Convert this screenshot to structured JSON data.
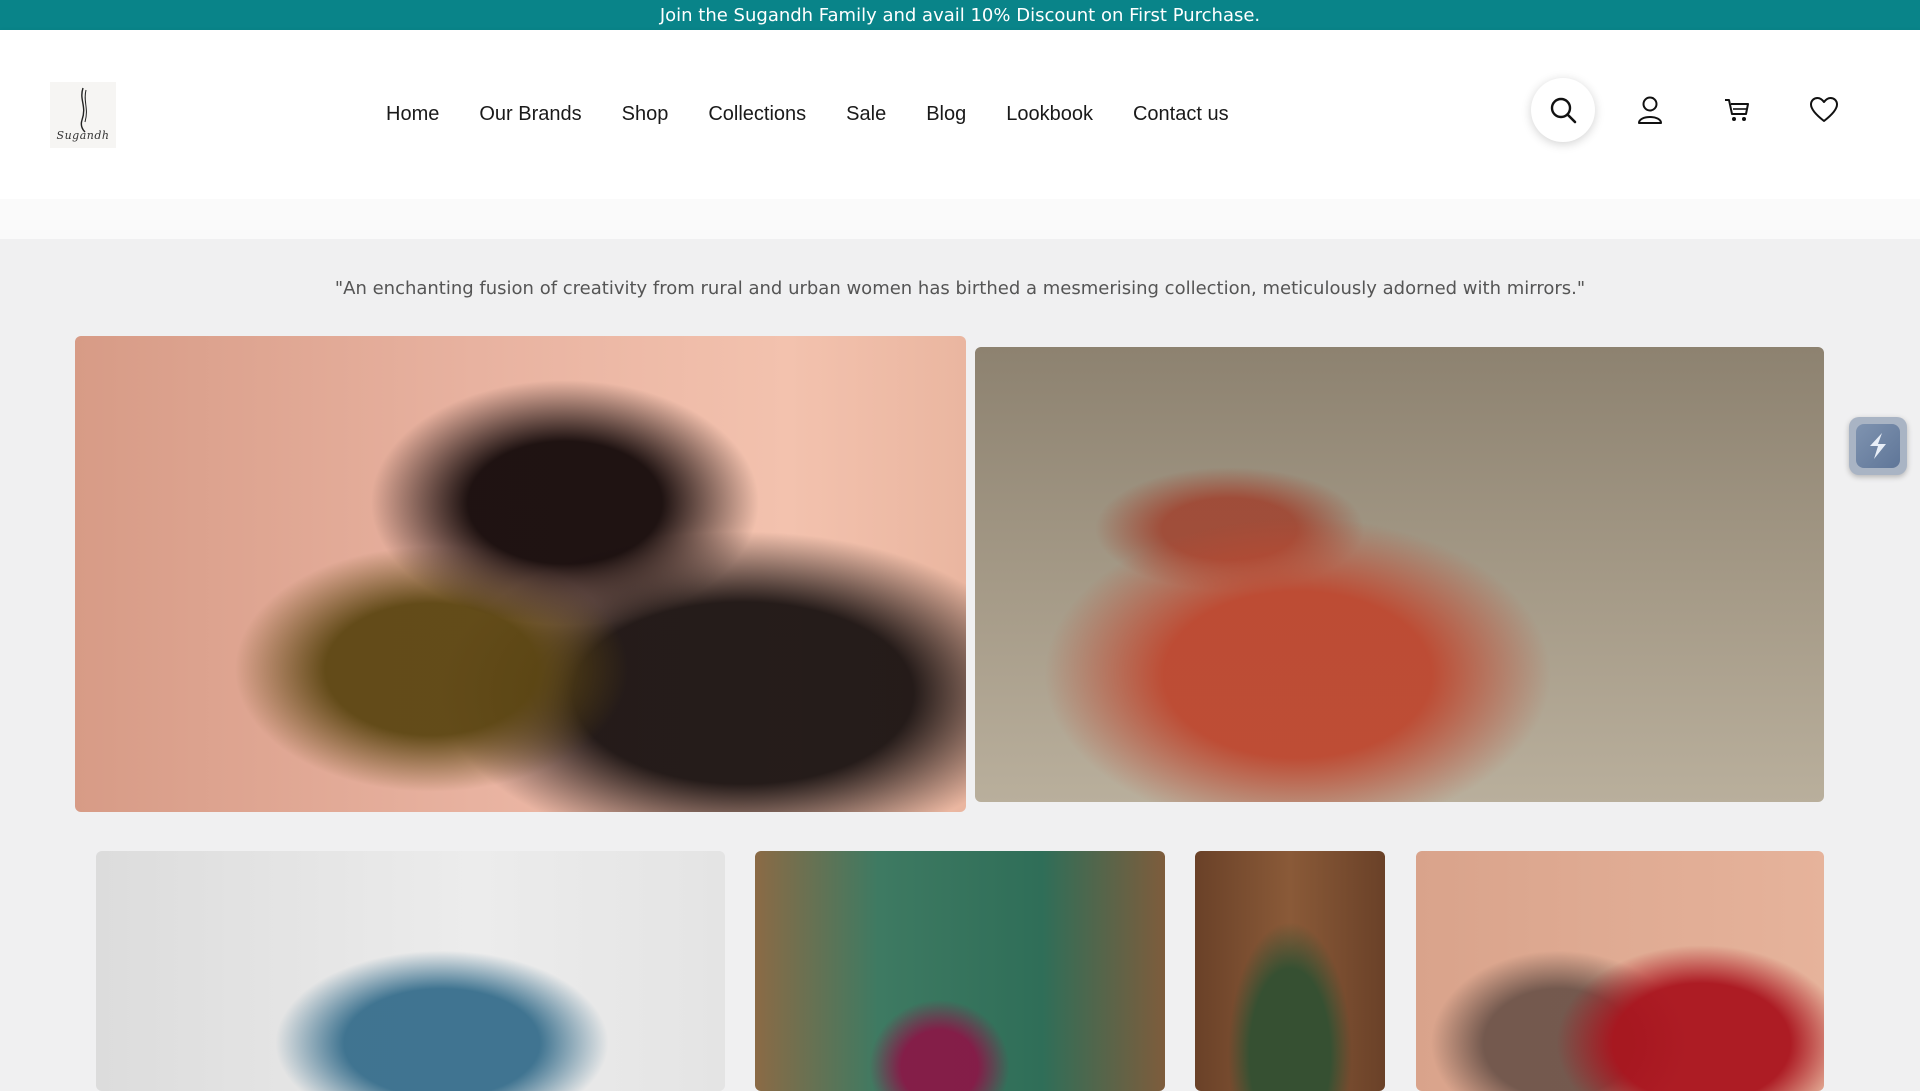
{
  "announcement": {
    "text": "Join the Sugandh Family and avail 10% Discount on First Purchase."
  },
  "brand": {
    "logo_text": "Sugandh"
  },
  "nav": {
    "items": [
      {
        "label": "Home"
      },
      {
        "label": "Our Brands"
      },
      {
        "label": "Shop"
      },
      {
        "label": "Collections"
      },
      {
        "label": "Sale"
      },
      {
        "label": "Blog"
      },
      {
        "label": "Lookbook"
      },
      {
        "label": "Contact us"
      }
    ]
  },
  "header_icons": [
    "search-icon",
    "user-icon",
    "cart-icon",
    "heart-icon"
  ],
  "lookbook": {
    "quote": "\"An enchanting fusion of creativity from rural and urban women has birthed a mesmerising collection, meticulously adorned with mirrors.\""
  },
  "colors": {
    "accent": "#098489",
    "page_bg": "#f0f0f1"
  }
}
